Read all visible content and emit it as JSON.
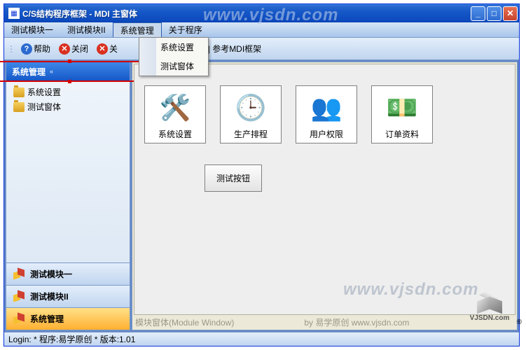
{
  "title": "C/S结构程序框架 - MDI 主窗体",
  "menubar": {
    "items": [
      "测试模块一",
      "测试模块II",
      "系统管理",
      "关于程序"
    ],
    "open_index": 2
  },
  "dropdown": {
    "items": [
      "系统设置",
      "测试窗体"
    ]
  },
  "toolbar": {
    "help": "帮助",
    "close": "关闭",
    "close2_partial": "关",
    "extra": "oolbar | 参考MDI框架"
  },
  "sidebar": {
    "header": "系统管理",
    "tree": [
      "系统设置",
      "测试窗体"
    ],
    "nav": [
      "测试模块一",
      "测试模块II",
      "系统管理"
    ],
    "active_nav": 2
  },
  "content": {
    "cards": [
      {
        "label": "系统设置",
        "emoji": "🛠️"
      },
      {
        "label": "生产排程",
        "emoji": "🕒"
      },
      {
        "label": "用户权限",
        "emoji": "👥"
      },
      {
        "label": "订单资料",
        "emoji": "💵"
      }
    ],
    "test_button": "测试按钮",
    "footer_left": "模块窗体(Module Window)",
    "footer_right": "by 易学原创 www.vjsdn.com"
  },
  "statusbar": "Login:    * 程序:易学原创 * 版本:1.01",
  "watermark": "www.vjsdn.com",
  "logo": "VJSDN.com"
}
